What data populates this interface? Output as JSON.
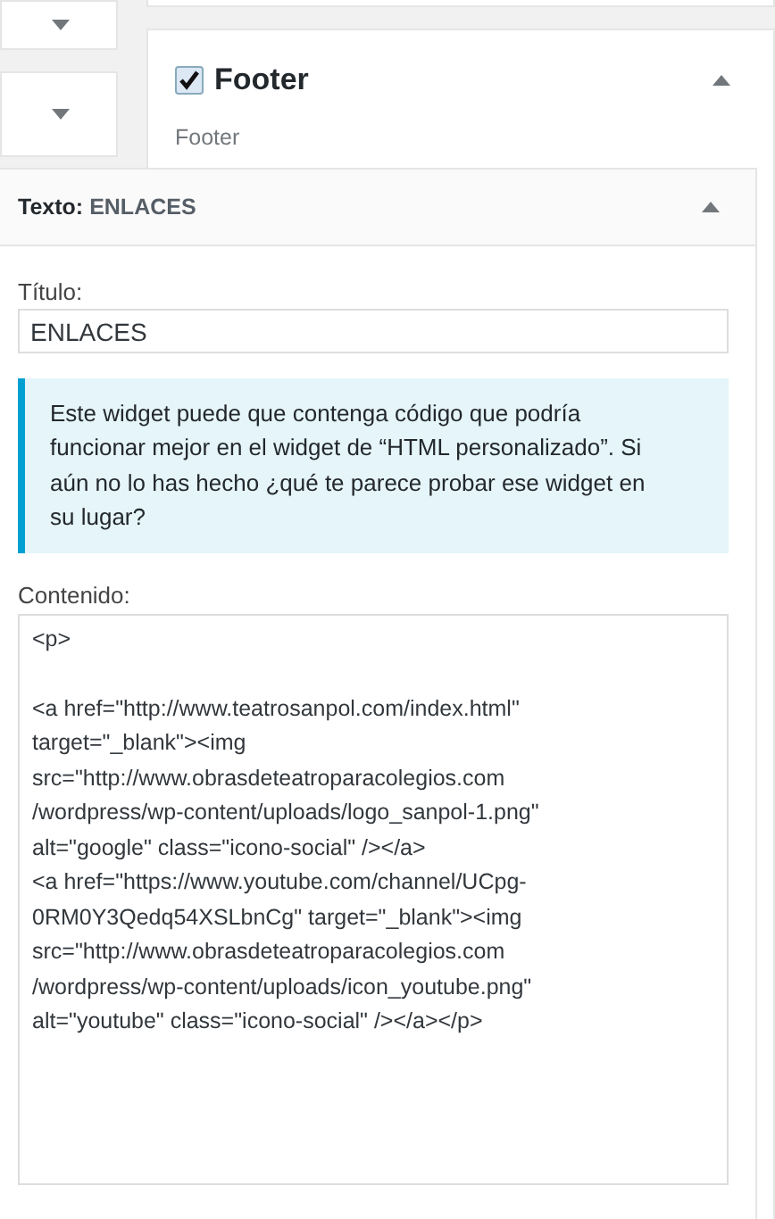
{
  "left_areas": [
    {
      "expanded": false
    },
    {
      "expanded": false
    }
  ],
  "footer_area": {
    "checked": true,
    "title": "Footer",
    "description": "Footer",
    "expanded": true
  },
  "widget": {
    "type_label": "Texto:",
    "title": "ENLACES",
    "expanded": true,
    "title_field": {
      "label": "Título:",
      "value": "ENLACES"
    },
    "notice": "Este widget puede que contenga código que podría funcionar mejor en el widget de “HTML personalizado”. Si aún no lo has hecho ¿qué te parece probar ese widget en su lugar?",
    "content_field": {
      "label": "Contenido:",
      "blocks": [
        [
          "<p>"
        ],
        [
          "<a href=\"http://www.teatrosanpol.com/index.html\"",
          "target=\"_blank\"><img",
          "src=\"http://www.obrasdeteatroparacolegios.com",
          "/wordpress/wp-content/uploads/logo_sanpol-1.png\"",
          "alt=\"google\" class=\"icono-social\" /></a>",
          "<a href=\"https://www.youtube.com/channel/UCpg-",
          "0RM0Y3Qedq54XSLbnCg\" target=\"_blank\"><img",
          "src=\"http://www.obrasdeteatroparacolegios.com",
          "/wordpress/wp-content/uploads/icon_youtube.png\"",
          "alt=\"youtube\" class=\"icono-social\" /></a></p>"
        ]
      ]
    }
  }
}
